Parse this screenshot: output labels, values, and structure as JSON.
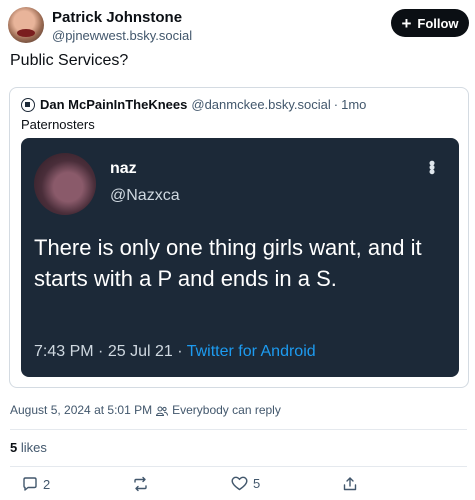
{
  "post": {
    "author_name": "Patrick Johnstone",
    "author_handle": "@pjnewwest.bsky.social",
    "follow_label": "Follow",
    "text": "Public Services?"
  },
  "quote": {
    "author_name": "Dan McPainInTheKnees",
    "author_handle": "@danmckee.bsky.social",
    "separator": "·",
    "time": "1mo",
    "text": "Paternosters",
    "embedded_tweet": {
      "name": "naz",
      "handle": "@Nazxca",
      "body": "There is only one thing girls want, and it starts with a P and ends in a S.",
      "time": "7:43 PM",
      "date": "25 Jul 21",
      "source": "Twitter for Android"
    }
  },
  "meta": {
    "date": "August 5, 2024 at 5:01 PM",
    "reply_setting": "Everybody can reply"
  },
  "stats": {
    "likes_count": "5",
    "likes_label": "likes"
  },
  "actions": {
    "reply_count": "2",
    "like_count": "5"
  },
  "colors": {
    "accent": "#1d9bf0",
    "text_muted": "#42576c",
    "tweet_bg": "#1c2938"
  }
}
